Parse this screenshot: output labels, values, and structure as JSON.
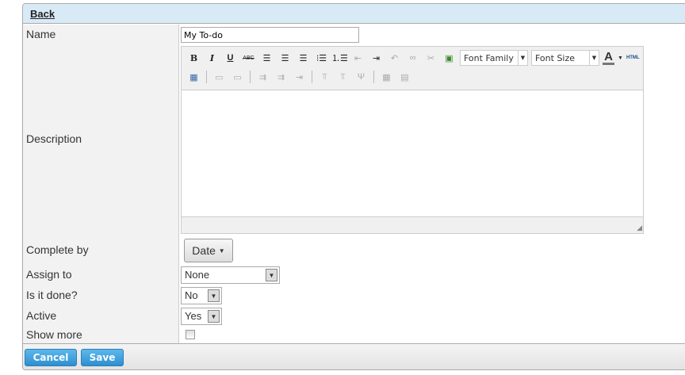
{
  "header": {
    "back": "Back"
  },
  "form": {
    "name": {
      "label": "Name",
      "value": "My To-do"
    },
    "description": {
      "label": "Description",
      "font_family": "Font Family",
      "font_size": "Font Size",
      "bold": "B",
      "italic": "I",
      "underline": "U",
      "strike": "ABC",
      "html": "HTML",
      "text_color": "A"
    },
    "complete_by": {
      "label": "Complete by",
      "button": "Date"
    },
    "assign_to": {
      "label": "Assign to",
      "value": "None"
    },
    "done": {
      "label": "Is it done?",
      "value": "No"
    },
    "active": {
      "label": "Active",
      "value": "Yes"
    },
    "show_more": {
      "label": "Show more",
      "checked": false
    }
  },
  "footer": {
    "cancel": "Cancel",
    "save": "Save"
  }
}
